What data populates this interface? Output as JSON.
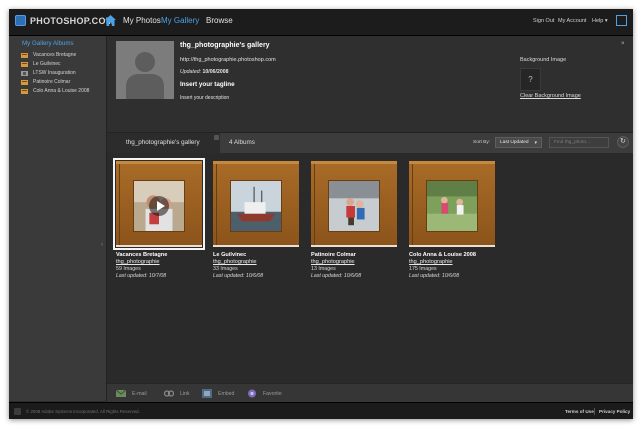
{
  "topbar": {
    "logo_text": "PHOTOSHOP.COM",
    "nav": [
      "My Photos",
      "My Gallery",
      "Browse"
    ],
    "sign_out": "Sign Out",
    "my_account": "My Account",
    "help": "Help ▾"
  },
  "sidebar": {
    "title": "My Gallery Albums",
    "items": [
      {
        "label": "Vacances Bretagne",
        "icon": "album-icon"
      },
      {
        "label": "Le Guilvinec",
        "icon": "album-icon"
      },
      {
        "label": "LTSW Inauguration",
        "icon": "locked-album-icon"
      },
      {
        "label": "Patinoire Colmar",
        "icon": "album-icon"
      },
      {
        "label": "Colo Anna & Louise 2008",
        "icon": "album-icon"
      }
    ]
  },
  "header": {
    "gallery_title": "thg_photographie's gallery",
    "url": "http://thg_photographie.photoshop.com",
    "updated_label": "Updated:",
    "updated_date": "10/06/2008",
    "tagline": "Insert your tagline",
    "description": "Insert your description",
    "bg_label": "Background Image",
    "bg_placeholder": "?",
    "bg_clear": "Clear Background Image",
    "close": "×"
  },
  "tabbar": {
    "gallery_tab": "thg_photographie's gallery",
    "albums_count": "4 Albums",
    "sort_label": "Sort By:",
    "sort_value": "Last Updated",
    "find_placeholder": "Find thg_photo...",
    "refresh_glyph": "↻"
  },
  "albums": [
    {
      "name": "Vacances Bretagne",
      "owner": "thg_photographie",
      "count": "59 Images",
      "updated": "Last updated: 10/7/08"
    },
    {
      "name": "Le Guilvinec",
      "owner": "thg_photographie",
      "count": "33 Images",
      "updated": "Last updated: 10/6/08"
    },
    {
      "name": "Patinoire Colmar",
      "owner": "thg_photographie",
      "count": "13 Images",
      "updated": "Last updated: 10/6/08"
    },
    {
      "name": "Colo Anna & Louise 2008",
      "owner": "thg_photographie",
      "count": "175 Images",
      "updated": "Last updated: 10/6/08"
    }
  ],
  "actions": [
    "E-mail",
    "Link",
    "Embed",
    "Favorite"
  ],
  "footer": {
    "copyright": "© 2008 Adobe Systems Incorporated. All Rights Reserved.",
    "terms": "Terms of Use",
    "privacy": "Privacy Policy"
  },
  "colors": {
    "accent": "#4aa3e8",
    "album_brown": "#a86b27",
    "window_bg": "#2d2d2d"
  }
}
